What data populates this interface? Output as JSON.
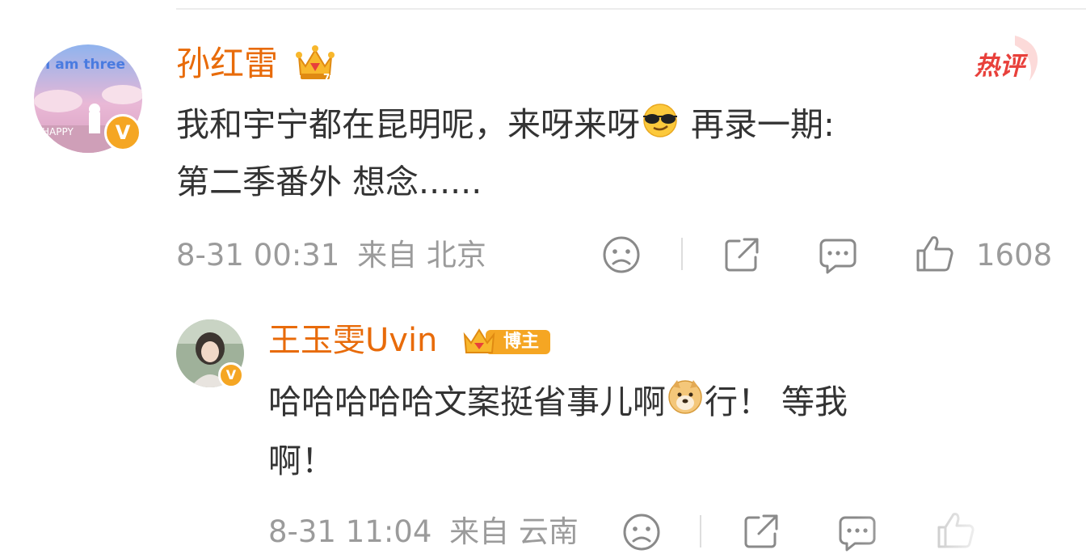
{
  "comment": {
    "user": "孙红雷",
    "hot_label": "热评",
    "text_part1": "我和宇宁都在昆明呢，来呀来呀",
    "text_part2": " 再录一期:",
    "text_line2": "第二季番外 想念......",
    "timestamp": "8-31 00:31",
    "location": "来自 北京",
    "likes": "1608",
    "avatar_text": "I am three",
    "avatar_text2": "HAPPY",
    "verified_glyph": "V"
  },
  "reply": {
    "user": "王玉雯Uvin",
    "badge_label": "博主",
    "text_part1": "哈哈哈哈哈文案挺省事儿啊",
    "text_part2": "行！ 等我",
    "text_line2": "啊！",
    "timestamp": "8-31 11:04",
    "location": "来自 云南",
    "verified_glyph": "V"
  },
  "colors": {
    "username": "#e86b0a",
    "meta": "#9b9b9b",
    "hot": "#e8403b",
    "verified": "#f5a623"
  },
  "icons": [
    "sad-face-icon",
    "share-icon",
    "comment-icon",
    "like-thumb-icon",
    "crown-icon",
    "sunglasses-emoji-icon",
    "doge-emoji-icon"
  ]
}
